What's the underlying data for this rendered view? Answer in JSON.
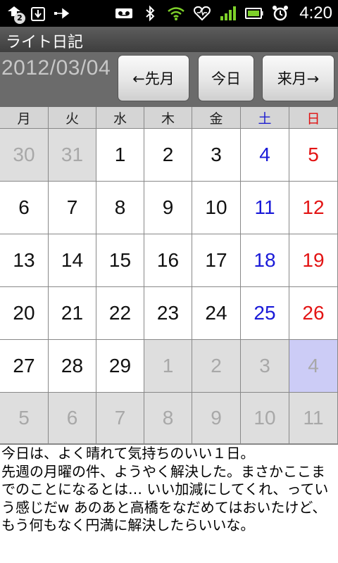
{
  "status_bar": {
    "time": "4:20",
    "notification_count": "2",
    "left_icons": [
      "sync-icon",
      "download-icon",
      "usb-icon"
    ],
    "right_icons": [
      "voicemail-icon",
      "bluetooth-icon",
      "wifi-icon",
      "heart-monitor-icon",
      "signal-icon",
      "battery-icon",
      "alarm-icon"
    ]
  },
  "app": {
    "title": "ライト日記"
  },
  "header": {
    "current_date": "2012/03/04",
    "prev_label": "←先月",
    "today_label": "今日",
    "next_label": "来月→"
  },
  "calendar": {
    "weekdays": [
      "月",
      "火",
      "水",
      "木",
      "金",
      "土",
      "日"
    ],
    "weeks": [
      [
        {
          "d": "30",
          "o": true
        },
        {
          "d": "31",
          "o": true
        },
        {
          "d": "1"
        },
        {
          "d": "2"
        },
        {
          "d": "3"
        },
        {
          "d": "4"
        },
        {
          "d": "5"
        }
      ],
      [
        {
          "d": "6"
        },
        {
          "d": "7"
        },
        {
          "d": "8"
        },
        {
          "d": "9"
        },
        {
          "d": "10"
        },
        {
          "d": "11"
        },
        {
          "d": "12"
        }
      ],
      [
        {
          "d": "13"
        },
        {
          "d": "14"
        },
        {
          "d": "15"
        },
        {
          "d": "16"
        },
        {
          "d": "17"
        },
        {
          "d": "18"
        },
        {
          "d": "19"
        }
      ],
      [
        {
          "d": "20"
        },
        {
          "d": "21"
        },
        {
          "d": "22"
        },
        {
          "d": "23"
        },
        {
          "d": "24"
        },
        {
          "d": "25"
        },
        {
          "d": "26"
        }
      ],
      [
        {
          "d": "27"
        },
        {
          "d": "28"
        },
        {
          "d": "29"
        },
        {
          "d": "1",
          "o": true
        },
        {
          "d": "2",
          "o": true
        },
        {
          "d": "3",
          "o": true
        },
        {
          "d": "4",
          "o": true,
          "s": true
        }
      ],
      [
        {
          "d": "5",
          "o": true
        },
        {
          "d": "6",
          "o": true
        },
        {
          "d": "7",
          "o": true
        },
        {
          "d": "8",
          "o": true
        },
        {
          "d": "9",
          "o": true
        },
        {
          "d": "10",
          "o": true
        },
        {
          "d": "11",
          "o": true
        }
      ]
    ]
  },
  "diary": {
    "text": "今日は、よく晴れて気持ちのいい１日。\n先週の月曜の件、ようやく解決した。まさかここまでのことになるとは… いい加減にしてくれ、っていう感じだw あのあと高橋をなだめてはおいたけど、もう何もなく円満に解決したらいいな。"
  },
  "colors": {
    "saturday": "#1a1ad8",
    "sunday": "#e31414",
    "other_month_bg": "#dedede",
    "selected_bg": "#ccccf6"
  }
}
